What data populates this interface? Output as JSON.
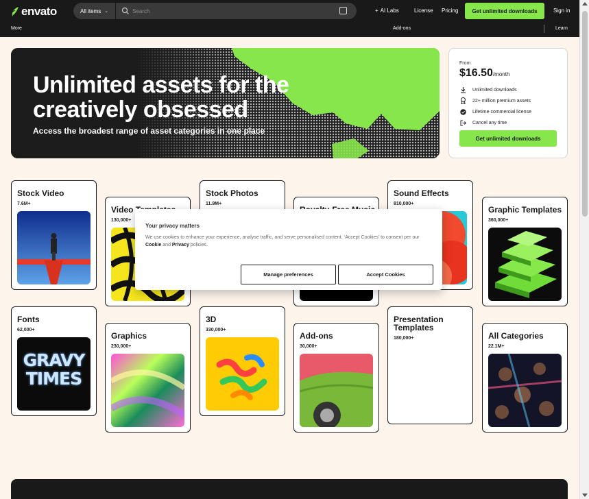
{
  "brand": {
    "name": "envato",
    "accent": "#87e64b",
    "dark": "#191919",
    "bg": "#fdf4ec"
  },
  "header": {
    "search_category": "All items",
    "search_placeholder": "Search",
    "nav": {
      "ai_labs": "AI Labs",
      "license": "License",
      "pricing": "Pricing"
    },
    "cta": "Get unlimited downloads",
    "sign_in": "Sign in",
    "row2": {
      "more": "More",
      "addons": "Add-ons",
      "learn": "Learn"
    }
  },
  "hero": {
    "title_line1": "Unlimited assets for the",
    "title_line2": "creatively obsessed",
    "subtitle": "Access the broadest range of asset categories in one place"
  },
  "pricing": {
    "from": "From",
    "price": "$16.50",
    "period": "/month",
    "features": [
      {
        "icon": "download-icon",
        "label": "Unlimited downloads"
      },
      {
        "icon": "award-icon",
        "label": "22+ million premium assets"
      },
      {
        "icon": "check-badge-icon",
        "label": "Lifetime commercial license"
      },
      {
        "icon": "exit-icon",
        "label": "Cancel any time"
      }
    ],
    "cta": "Get unlimited downloads"
  },
  "categories": [
    {
      "title": "Stock Video",
      "count": "7.6M+"
    },
    {
      "title": "Video Templates",
      "count": "130,000+"
    },
    {
      "title": "Stock Photos",
      "count": "11.9M+"
    },
    {
      "title": "Royalty-Free Music",
      "count": ""
    },
    {
      "title": "Sound Effects",
      "count": "810,000+"
    },
    {
      "title": "Graphic Templates",
      "count": "360,000+"
    },
    {
      "title": "Fonts",
      "count": "62,000+"
    },
    {
      "title": "Graphics",
      "count": "230,000+"
    },
    {
      "title": "3D",
      "count": "330,000+"
    },
    {
      "title": "Add-ons",
      "count": "30,000+"
    },
    {
      "title": "Presentation Templates",
      "count": "180,000+"
    },
    {
      "title": "All Categories",
      "count": "22.1M+"
    }
  ],
  "fonts_thumb": {
    "line1": "GRAVY",
    "line2": "TIMES"
  },
  "cookie": {
    "title": "Your privacy matters",
    "body_start": "We use cookies to enhance your experience, analyse traffic, and serve personalised content. ‘Accept Cookies’ to consent per our ",
    "link_cookie": "Cookie",
    "body_and": " and ",
    "link_privacy": "Privacy",
    "body_end": " policies.",
    "manage": "Manage preferences",
    "accept": "Accept Cookies"
  }
}
